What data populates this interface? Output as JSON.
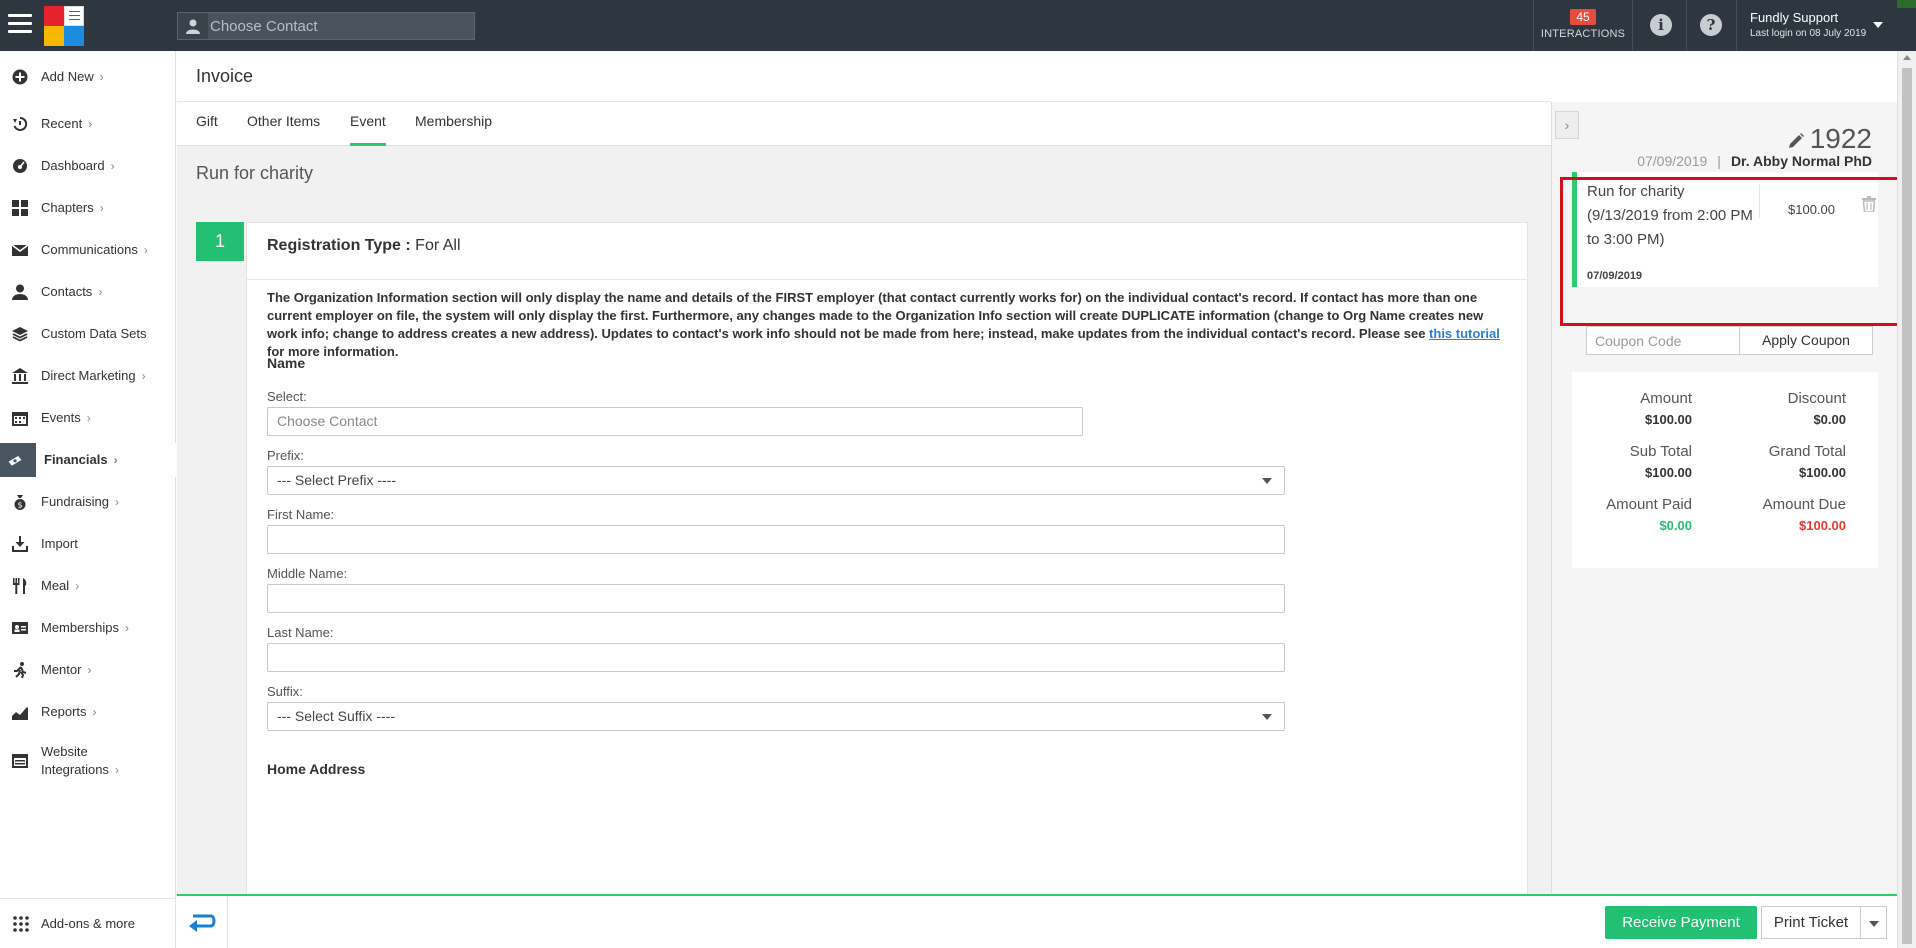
{
  "topbar": {
    "search_placeholder": "Choose Contact",
    "interactions_count": "45",
    "interactions_label": "INTERACTIONS",
    "info_icon": "i",
    "help_icon": "?",
    "user_name": "Fundly Support",
    "last_login": "Last login on 08 July 2019"
  },
  "sidebar": {
    "items": [
      {
        "label": "Add New",
        "icon": "plus-circle-icon",
        "chevron": true
      },
      {
        "label": "Recent",
        "icon": "history-icon",
        "chevron": true
      },
      {
        "label": "Dashboard",
        "icon": "dashboard-icon",
        "chevron": true
      },
      {
        "label": "Chapters",
        "icon": "grid-icon",
        "chevron": true
      },
      {
        "label": "Communications",
        "icon": "envelope-icon",
        "chevron": true
      },
      {
        "label": "Contacts",
        "icon": "user-icon",
        "chevron": true
      },
      {
        "label": "Custom Data Sets",
        "icon": "layers-icon",
        "chevron": false
      },
      {
        "label": "Direct Marketing",
        "icon": "bank-icon",
        "chevron": true
      },
      {
        "label": "Events",
        "icon": "calendar-icon",
        "chevron": true
      },
      {
        "label": "Financials",
        "icon": "money-icon",
        "chevron": true,
        "active": true
      },
      {
        "label": "Fundraising",
        "icon": "moneybag-icon",
        "chevron": true
      },
      {
        "label": "Import",
        "icon": "download-icon",
        "chevron": false
      },
      {
        "label": "Meal",
        "icon": "cutlery-icon",
        "chevron": true
      },
      {
        "label": "Memberships",
        "icon": "id-card-icon",
        "chevron": true
      },
      {
        "label": "Mentor",
        "icon": "running-icon",
        "chevron": true
      },
      {
        "label": "Reports",
        "icon": "chart-icon",
        "chevron": true
      },
      {
        "label": "Website Integrations",
        "icon": "browser-icon",
        "chevron": true
      }
    ],
    "addons_label": "Add-ons & more"
  },
  "main": {
    "title": "Invoice",
    "tabs": [
      {
        "label": "Gift",
        "active": false
      },
      {
        "label": "Other Items",
        "active": false
      },
      {
        "label": "Event",
        "active": true
      },
      {
        "label": "Membership",
        "active": false
      }
    ],
    "event_title": "Run for charity",
    "step_number": "1",
    "registration_type_label": "Registration Type :",
    "registration_type_value": "For All",
    "notice_before_link": "The Organization Information section will only display the name and details of the FIRST employer (that contact currently works for) on the individual contact's record. If contact has more than one current employer on file, the system will only display the first. Furthermore, any changes made to the Organization Info section will create DUPLICATE information (change to Org Name creates new work info; change to address creates a new address). Updates to contact's work info should not be made from here; instead, make updates from the individual contact's record. Please see ",
    "notice_link": "this tutorial",
    "notice_after_link": " for more information.",
    "name_section": "Name",
    "select_label": "Select:",
    "select_placeholder": "Choose Contact",
    "prefix_label": "Prefix:",
    "prefix_value": "--- Select Prefix ----",
    "first_name_label": "First Name:",
    "middle_name_label": "Middle Name:",
    "last_name_label": "Last Name:",
    "suffix_label": "Suffix:",
    "suffix_value": "--- Select Suffix ----",
    "home_address_section": "Home Address"
  },
  "right_panel": {
    "invoice_number": "1922",
    "date": "07/09/2019",
    "separator": "|",
    "contact": "Dr. Abby Normal PhD",
    "line_item": {
      "description": "Run for charity (9/13/2019 from 2:00 PM to 3:00 PM)",
      "date": "07/09/2019",
      "amount": "$100.00"
    },
    "coupon_placeholder": "Coupon Code",
    "apply_coupon": "Apply Coupon",
    "totals": {
      "amount_label": "Amount",
      "amount": "$100.00",
      "discount_label": "Discount",
      "discount": "$0.00",
      "subtotal_label": "Sub Total",
      "subtotal": "$100.00",
      "grandtotal_label": "Grand Total",
      "grandtotal": "$100.00",
      "paid_label": "Amount Paid",
      "paid": "$0.00",
      "due_label": "Amount Due",
      "due": "$100.00"
    }
  },
  "bottombar": {
    "receive_payment": "Receive Payment",
    "print_ticket": "Print Ticket"
  },
  "colors": {
    "topbar": "#2e3640",
    "accent_green": "#23c073",
    "alert_red": "#e53935",
    "highlight_box": "#d0101a"
  }
}
